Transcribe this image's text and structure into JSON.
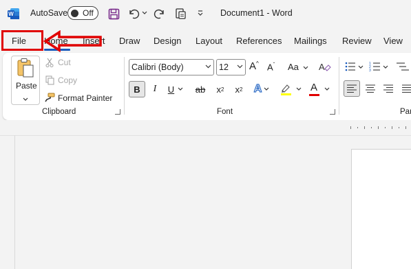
{
  "titlebar": {
    "autosave_label": "AutoSave",
    "autosave_state": "Off",
    "doc_title": "Document1  -  Word"
  },
  "tabs": [
    "File",
    "Home",
    "Insert",
    "Draw",
    "Design",
    "Layout",
    "References",
    "Mailings",
    "Review",
    "View"
  ],
  "active_tab": "Home",
  "clipboard": {
    "paste": "Paste",
    "cut": "Cut",
    "copy": "Copy",
    "format_painter": "Format Painter",
    "group_label": "Clipboard"
  },
  "font": {
    "font_name": "Calibri (Body)",
    "font_size": "12",
    "grow": "A",
    "shrink": "A",
    "change_case": "Aa",
    "bold": "B",
    "italic": "I",
    "underline": "U",
    "strike": "ab",
    "subscript": "x",
    "subscript_mark": "2",
    "superscript": "x",
    "superscript_mark": "2",
    "text_effects": "A",
    "font_color": "A",
    "group_label": "Font"
  },
  "paragraph": {
    "group_label": "Par"
  },
  "colors": {
    "accent": "#185abd",
    "annotation_red": "#e00000",
    "font_color_bar": "#e00000",
    "highlight_bar": "#ffff00",
    "save_icon": "#7a2d8c"
  },
  "annotations": {
    "file_highlight": "red-rectangle-around-file",
    "arrow": "red-arrow-pointing-left-to-file"
  }
}
